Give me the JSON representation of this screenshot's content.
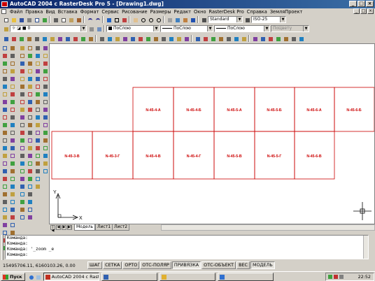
{
  "window": {
    "title": "AutoCAD 2004 с RasterDesk Pro 5 - [Drawing1.dwg]",
    "buttons": [
      "_",
      "□",
      "×"
    ]
  },
  "menu": [
    "Файл",
    "Правка",
    "Вид",
    "Вставка",
    "Формат",
    "Сервис",
    "Рисование",
    "Размеры",
    "Редакт",
    "Окно",
    "RasterDesk Pro",
    "Справка",
    "ЗемляПроект"
  ],
  "doc_buttons": [
    "_",
    "□",
    "×"
  ],
  "toolbar1": {
    "text_style": "Standard",
    "dim_style": "ISO-25"
  },
  "toolbar2": {
    "layer": "0",
    "color": "ПоСлою",
    "linetype": "ПоСлою",
    "lineweight": "ПоСлою",
    "plotstyle": "ПоЦвету"
  },
  "drawing": {
    "sheets_row1": [
      "N-45-4-А",
      "N-45-4-Б",
      "N-45-5-А",
      "N-45-5-Б",
      "N-45-6-А",
      "N-45-6-Б"
    ],
    "sheets_row2": [
      "N-45-3-В",
      "N-45-3-Г",
      "N-45-4-В",
      "N-45-4-Г",
      "N-45-5-В",
      "N-45-5-Г",
      "N-45-6-В"
    ],
    "ucs_x": "X",
    "ucs_y": "Y"
  },
  "layout_tabs": [
    "Модель",
    "Лист1",
    "Лист2"
  ],
  "command": {
    "lines": [
      "Команда:",
      "Команда:",
      "Команда: '_zoom _e",
      "Команда:"
    ]
  },
  "status": {
    "coords": "15495706.11, 6160103.26, 0.00",
    "buttons": [
      {
        "label": "ШАГ",
        "on": false
      },
      {
        "label": "СЕТКА",
        "on": false
      },
      {
        "label": "ОРТО",
        "on": false
      },
      {
        "label": "ОТС-ПОЛЯР",
        "on": false
      },
      {
        "label": "ПРИВЯЗКА",
        "on": true
      },
      {
        "label": "ОТС-ОБЪЕКТ",
        "on": false
      },
      {
        "label": "ВЕС",
        "on": false
      },
      {
        "label": "МОДЕЛЬ",
        "on": true
      }
    ]
  },
  "taskbar": {
    "start": "Пуск",
    "tasks": [
      {
        "label": "AutoCAD 2004 с Rast...",
        "active": true
      },
      {
        "label": "",
        "active": false
      },
      {
        "label": "",
        "active": false
      },
      {
        "label": "",
        "active": false
      }
    ],
    "time": "22:52"
  },
  "colors": {
    "sheet_line": "#cc0000",
    "sheet_text": "#cc0000",
    "title_bar": "#0a246a"
  }
}
